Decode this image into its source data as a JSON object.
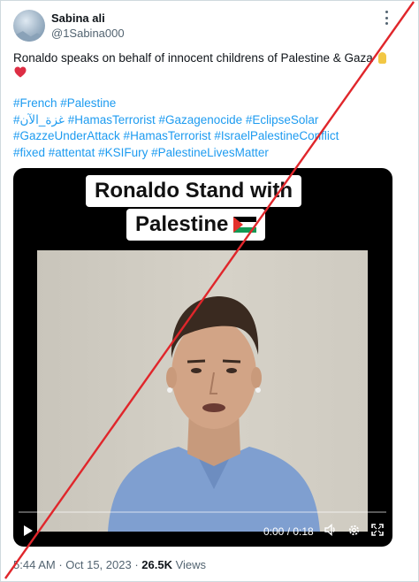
{
  "author": {
    "display_name": "Sabina ali",
    "handle": "@1Sabina000",
    "avatar_icon": "landscape-avatar"
  },
  "more_icon": "more-horizontal-icon",
  "tweet": {
    "text": "Ronaldo speaks on behalf of innocent childrens of Palestine & Gaza",
    "trailing_emojis": [
      "lightbulb-emoji",
      "red-heart-emoji"
    ],
    "hashtag_lines": [
      "#French #Palestine",
      "#غزة_الآن #HamasTerrorist #Gazagenocide #EclipseSolar",
      "#GazzeUnderAttack  #HamasTerrorist #IsraelPalestineConflict",
      "#fixed #attentat #KSIFury #PalestineLivesMatter"
    ]
  },
  "media": {
    "caption_line1": "Ronaldo Stand with",
    "caption_line2": "Palestine",
    "caption_flag": "palestine-flag-emoji",
    "time_display": "0:00 / 0:18",
    "progress": 0,
    "controls": [
      "play-icon",
      "volume-icon",
      "settings-icon",
      "fullscreen-icon"
    ]
  },
  "footer": {
    "time": "5:44 AM",
    "separator": " · ",
    "date": "Oct 15, 2023",
    "views_count": "26.5K",
    "views_label": " Views"
  },
  "overlay": {
    "mark": "red-diagonal-cross-line",
    "color": "#e0262b"
  },
  "colors": {
    "link": "#1d9bf0",
    "secondary_text": "#536471",
    "border": "#cfd9de"
  }
}
